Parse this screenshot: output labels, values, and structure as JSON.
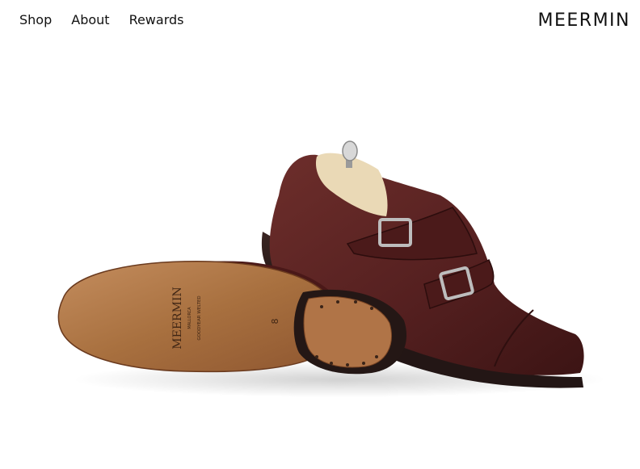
{
  "nav": {
    "items": [
      {
        "label": "Shop"
      },
      {
        "label": "About"
      },
      {
        "label": "Rewards"
      }
    ]
  },
  "brand": {
    "name": "MEERMIN"
  },
  "hero": {
    "sole_stamp": "MEERMIN",
    "sole_stamp_sub": "MALLORCA",
    "sole_stamp_line": "GOODYEAR WELTED",
    "size_mark": "8",
    "colors": {
      "leather": "#5a2424",
      "leather_dark": "#3a1414",
      "sole": "#a0673f",
      "sole_light": "#bf8558",
      "heel": "#2c1d1b",
      "buckle": "#b8b8b8",
      "tree_wood": "#e8d7b4"
    }
  }
}
